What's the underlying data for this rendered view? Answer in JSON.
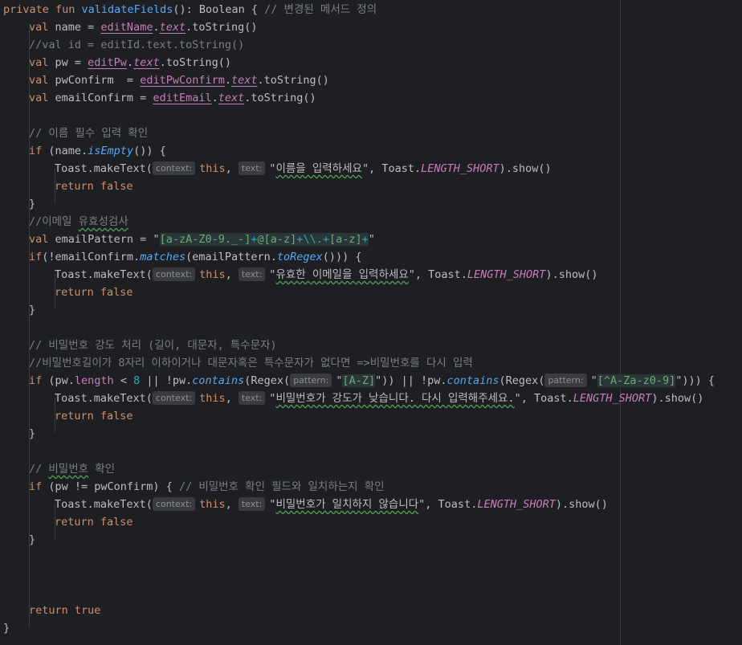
{
  "editor": {
    "lines": [
      {
        "indent": 0,
        "tokens": [
          {
            "t": "private fun ",
            "c": "kw"
          },
          {
            "t": "validateFields",
            "c": "fn"
          },
          {
            "t": "(): Boolean { "
          },
          {
            "t": "// 변경된 메서드 정의",
            "c": "cm"
          }
        ]
      },
      {
        "indent": 1,
        "tokens": [
          {
            "t": "val ",
            "c": "kw"
          },
          {
            "t": "name = "
          },
          {
            "t": "editName",
            "c": "prop ul"
          },
          {
            "t": "."
          },
          {
            "t": "text",
            "c": "prop italic ul"
          },
          {
            "t": ".toString()"
          }
        ]
      },
      {
        "indent": 1,
        "tokens": [
          {
            "t": "//val id = editId.text.toString()",
            "c": "cm"
          }
        ]
      },
      {
        "indent": 1,
        "tokens": [
          {
            "t": "val ",
            "c": "kw"
          },
          {
            "t": "pw = "
          },
          {
            "t": "editPw",
            "c": "prop ul"
          },
          {
            "t": "."
          },
          {
            "t": "text",
            "c": "prop italic ul"
          },
          {
            "t": ".toString()"
          }
        ]
      },
      {
        "indent": 1,
        "tokens": [
          {
            "t": "val ",
            "c": "kw"
          },
          {
            "t": "pwConfirm  = "
          },
          {
            "t": "editPwConfirm",
            "c": "prop ul"
          },
          {
            "t": "."
          },
          {
            "t": "text",
            "c": "prop italic ul"
          },
          {
            "t": ".toString()"
          }
        ]
      },
      {
        "indent": 1,
        "tokens": [
          {
            "t": "val ",
            "c": "kw"
          },
          {
            "t": "emailConfirm = "
          },
          {
            "t": "editEmail",
            "c": "prop ul"
          },
          {
            "t": "."
          },
          {
            "t": "text",
            "c": "prop italic ul"
          },
          {
            "t": ".toString()"
          }
        ]
      },
      {
        "indent": 0,
        "tokens": []
      },
      {
        "indent": 1,
        "tokens": [
          {
            "t": "// 이름 필수 입력 확인",
            "c": "cm"
          }
        ]
      },
      {
        "indent": 1,
        "tokens": [
          {
            "t": "if ",
            "c": "kw"
          },
          {
            "t": "(name."
          },
          {
            "t": "isEmpty",
            "c": "fn italic"
          },
          {
            "t": "()) {"
          }
        ]
      },
      {
        "indent": 2,
        "tokens": [
          {
            "t": "Toast.makeText("
          },
          {
            "hint": "context:"
          },
          {
            "t": "this",
            "c": "kw"
          },
          {
            "t": ", "
          },
          {
            "hint": "text:"
          },
          {
            "t": "\""
          },
          {
            "t": "이름을 입력하세요",
            "c": "wavy"
          },
          {
            "t": "\""
          },
          {
            "t": ", Toast."
          },
          {
            "t": "LENGTH_SHORT",
            "c": "static"
          },
          {
            "t": ").show()"
          }
        ]
      },
      {
        "indent": 2,
        "tokens": [
          {
            "t": "return false",
            "c": "kw"
          }
        ]
      },
      {
        "indent": 1,
        "tokens": [
          {
            "t": "}"
          }
        ]
      },
      {
        "indent": 1,
        "tokens": [
          {
            "t": "//이메일 ",
            "c": "cm"
          },
          {
            "t": "유효성검사",
            "c": "cm wavy"
          }
        ]
      },
      {
        "indent": 1,
        "tokens": [
          {
            "t": "val ",
            "c": "kw"
          },
          {
            "t": "emailPattern = "
          },
          {
            "t": "\""
          },
          {
            "t": "[a-zA-Z0-9._-]",
            "c": "rx"
          },
          {
            "t": "+",
            "c": "rxo"
          },
          {
            "t": "@",
            "c": "rx"
          },
          {
            "t": "[a-z]",
            "c": "rx"
          },
          {
            "t": "+",
            "c": "rxo"
          },
          {
            "t": "\\\\.",
            "c": "rxo"
          },
          {
            "t": "+",
            "c": "rxo"
          },
          {
            "t": "[a-z]",
            "c": "rx"
          },
          {
            "t": "+",
            "c": "rxo"
          },
          {
            "t": "\""
          }
        ]
      },
      {
        "indent": 1,
        "tokens": [
          {
            "t": "if",
            "c": "kw"
          },
          {
            "t": "(!emailConfirm."
          },
          {
            "t": "matches",
            "c": "fn italic"
          },
          {
            "t": "(emailPattern."
          },
          {
            "t": "toRegex",
            "c": "fn italic"
          },
          {
            "t": "())) {"
          }
        ]
      },
      {
        "indent": 2,
        "tokens": [
          {
            "t": "Toast.makeText("
          },
          {
            "hint": "context:"
          },
          {
            "t": "this",
            "c": "kw"
          },
          {
            "t": ", "
          },
          {
            "hint": "text:"
          },
          {
            "t": "\""
          },
          {
            "t": "유효한 이메일을 입력하세요",
            "c": "wavy"
          },
          {
            "t": "\""
          },
          {
            "t": ", Toast."
          },
          {
            "t": "LENGTH_SHORT",
            "c": "static"
          },
          {
            "t": ").show()"
          }
        ]
      },
      {
        "indent": 2,
        "tokens": [
          {
            "t": "return false",
            "c": "kw"
          }
        ]
      },
      {
        "indent": 1,
        "tokens": [
          {
            "t": "}"
          }
        ]
      },
      {
        "indent": 0,
        "tokens": []
      },
      {
        "indent": 1,
        "tokens": [
          {
            "t": "// 비밀번호 강도 처리 (길이, 대문자, 특수문자)",
            "c": "cm"
          }
        ]
      },
      {
        "indent": 1,
        "tokens": [
          {
            "t": "//비밀번호길이가 8자리 이하이거나 대문자혹은 특수문자가 없다면 =>비밀번호를 다시 입력",
            "c": "cm"
          }
        ]
      },
      {
        "indent": 1,
        "tokens": [
          {
            "t": "if ",
            "c": "kw"
          },
          {
            "t": "(pw."
          },
          {
            "t": "length",
            "c": "prop"
          },
          {
            "t": " < "
          },
          {
            "t": "8",
            "c": "num"
          },
          {
            "t": " || !pw."
          },
          {
            "t": "contains",
            "c": "fn italic"
          },
          {
            "t": "(Regex("
          },
          {
            "hint": "pattern:"
          },
          {
            "t": "\""
          },
          {
            "t": "[A-Z]",
            "c": "rx"
          },
          {
            "t": "\""
          },
          {
            "t": ")) || !pw."
          },
          {
            "t": "contains",
            "c": "fn italic"
          },
          {
            "t": "(Regex("
          },
          {
            "hint": "pattern:"
          },
          {
            "t": "\""
          },
          {
            "t": "[^A-Za-z0-9]",
            "c": "rx"
          },
          {
            "t": "\""
          },
          {
            "t": "))) {"
          }
        ]
      },
      {
        "indent": 2,
        "tokens": [
          {
            "t": "Toast.makeText("
          },
          {
            "hint": "context:"
          },
          {
            "t": "this",
            "c": "kw"
          },
          {
            "t": ", "
          },
          {
            "hint": "text:"
          },
          {
            "t": "\""
          },
          {
            "t": "비밀번호가 강도가 낮습니다. 다시 입력해주세요.",
            "c": "wavy"
          },
          {
            "t": "\""
          },
          {
            "t": ", Toast."
          },
          {
            "t": "LENGTH_SHORT",
            "c": "static"
          },
          {
            "t": ").show()"
          }
        ]
      },
      {
        "indent": 2,
        "tokens": [
          {
            "t": "return false",
            "c": "kw"
          }
        ]
      },
      {
        "indent": 1,
        "tokens": [
          {
            "t": "}"
          }
        ]
      },
      {
        "indent": 0,
        "tokens": []
      },
      {
        "indent": 1,
        "tokens": [
          {
            "t": "// ",
            "c": "cm"
          },
          {
            "t": "비밀번호",
            "c": "cm wavy"
          },
          {
            "t": " 확인",
            "c": "cm"
          }
        ]
      },
      {
        "indent": 1,
        "tokens": [
          {
            "t": "if ",
            "c": "kw"
          },
          {
            "t": "(pw != pwConfirm) { "
          },
          {
            "t": "// 비밀번호 확인 필드와 일치하는지 확인",
            "c": "cm"
          }
        ]
      },
      {
        "indent": 2,
        "tokens": [
          {
            "t": "Toast.makeText("
          },
          {
            "hint": "context:"
          },
          {
            "t": "this",
            "c": "kw"
          },
          {
            "t": ", "
          },
          {
            "hint": "text:"
          },
          {
            "t": "\""
          },
          {
            "t": "비밀번호가 일치하지 않습니다",
            "c": "wavy"
          },
          {
            "t": "\""
          },
          {
            "t": ", Toast."
          },
          {
            "t": "LENGTH_SHORT",
            "c": "static"
          },
          {
            "t": ").show()"
          }
        ]
      },
      {
        "indent": 2,
        "tokens": [
          {
            "t": "return false",
            "c": "kw"
          }
        ]
      },
      {
        "indent": 1,
        "tokens": [
          {
            "t": "}"
          }
        ]
      },
      {
        "indent": 0,
        "tokens": []
      },
      {
        "indent": 0,
        "tokens": []
      },
      {
        "indent": 0,
        "tokens": []
      },
      {
        "indent": 1,
        "tokens": [
          {
            "t": "return true",
            "c": "kw"
          }
        ]
      },
      {
        "indent": 0,
        "tokens": [
          {
            "t": "}"
          }
        ]
      }
    ]
  }
}
